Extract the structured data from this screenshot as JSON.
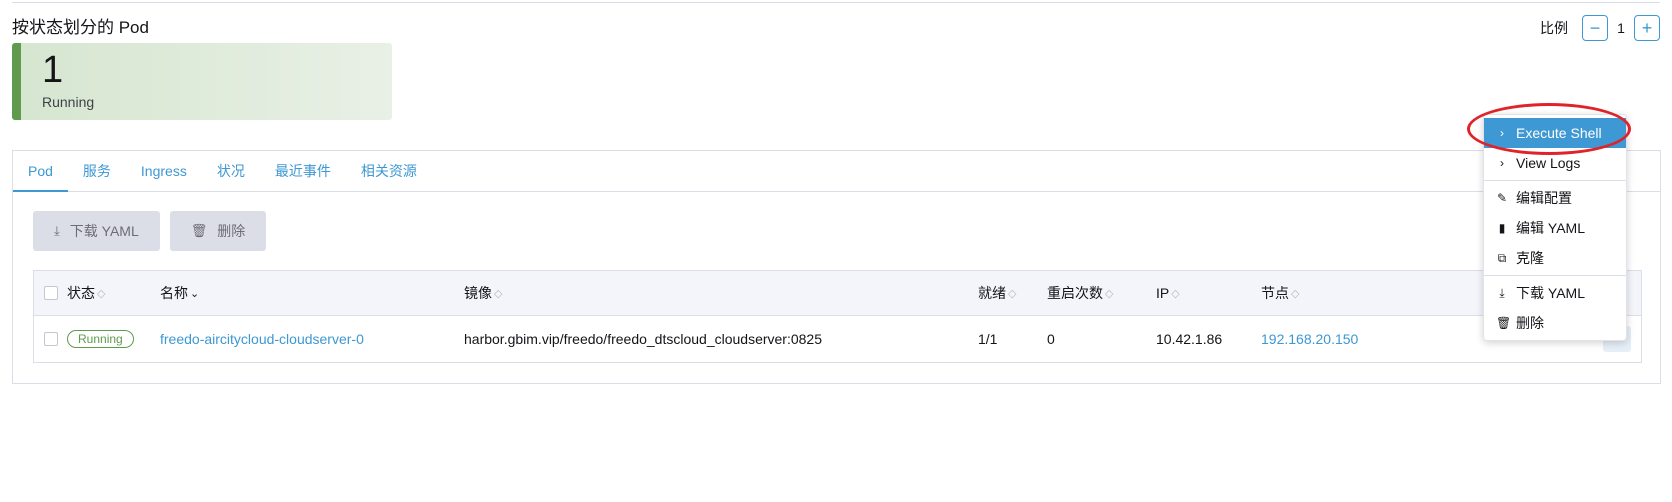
{
  "section": {
    "title": "按状态划分的 Pod"
  },
  "scale": {
    "label": "比例",
    "value": "1",
    "minus": "−",
    "plus": "+"
  },
  "state_card": {
    "count": "1",
    "label": "Running"
  },
  "tabs": [
    {
      "label": "Pod"
    },
    {
      "label": "服务"
    },
    {
      "label": "Ingress"
    },
    {
      "label": "状况"
    },
    {
      "label": "最近事件"
    },
    {
      "label": "相关资源"
    }
  ],
  "actions": {
    "download": "下载 YAML",
    "delete": "删除"
  },
  "table": {
    "headers": {
      "state": "状态",
      "name": "名称",
      "image": "镜像",
      "ready": "就绪",
      "restarts": "重启次数",
      "ip": "IP",
      "node": "节点"
    },
    "row": {
      "state": "Running",
      "name": "freedo-aircitycloud-cloudserver-0",
      "image": "harbor.gbim.vip/freedo/freedo_dtscloud_cloudserver:0825",
      "ready": "1/1",
      "restarts": "0",
      "ip": "10.42.1.86",
      "node": "192.168.20.150"
    }
  },
  "context_menu": {
    "execute_shell": "Execute Shell",
    "view_logs": "View Logs",
    "edit_config": "编辑配置",
    "edit_yaml": "编辑 YAML",
    "clone": "克隆",
    "download_yaml": "下载 YAML",
    "delete": "删除"
  },
  "colors": {
    "accent": "#3d98d3",
    "running": "#5f9a4e",
    "highlight_ring": "#e0232a"
  }
}
